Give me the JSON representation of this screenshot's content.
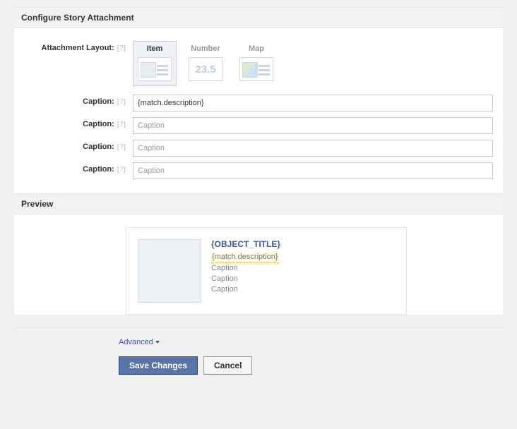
{
  "headers": {
    "configure": "Configure Story Attachment",
    "preview": "Preview"
  },
  "labels": {
    "attachment_layout": "Attachment Layout:",
    "caption": "Caption:"
  },
  "layout_tiles": {
    "item": "Item",
    "number": "Number",
    "number_value": "23.5",
    "map": "Map"
  },
  "captions": {
    "c1_value": "{match.description}",
    "c2_placeholder": "Caption",
    "c3_placeholder": "Caption",
    "c4_placeholder": "Caption"
  },
  "preview": {
    "object_title": "{OBJECT_TITLE}",
    "line1": "{match.description}",
    "line2": "Caption",
    "line3": "Caption",
    "line4": "Caption"
  },
  "actions": {
    "advanced": "Advanced",
    "save": "Save Changes",
    "cancel": "Cancel"
  },
  "help_glyph": "[?]"
}
